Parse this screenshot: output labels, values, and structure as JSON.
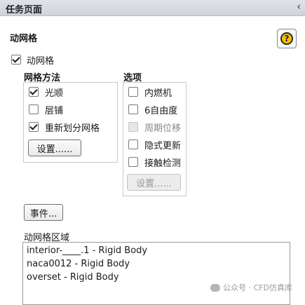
{
  "titlebar": {
    "title": "任务页面",
    "collapse_icon": "chevron-left-icon"
  },
  "panel": {
    "title": "动网格",
    "help_icon": "help-icon",
    "help_glyph": "?"
  },
  "dynamic_mesh": {
    "label": "动网格",
    "checked": true
  },
  "mesh_methods": {
    "title": "网格方法",
    "options": [
      {
        "label": "光顺",
        "checked": true
      },
      {
        "label": "层铺",
        "checked": false
      },
      {
        "label": "重新划分网格",
        "checked": true
      }
    ],
    "settings_button": "设置......"
  },
  "options": {
    "title": "选项",
    "items": [
      {
        "label": "内燃机",
        "checked": false,
        "disabled": false
      },
      {
        "label": "6自由度",
        "checked": false,
        "disabled": false
      },
      {
        "label": "周期位移",
        "checked": false,
        "disabled": true
      },
      {
        "label": "隐式更新",
        "checked": false,
        "disabled": false
      },
      {
        "label": "接触检测",
        "checked": false,
        "disabled": false
      }
    ],
    "settings_button": "设置......"
  },
  "events_button": "事件...",
  "zones": {
    "title": "动网格区域",
    "items": [
      "interior-____.1 - Rigid Body",
      "naca0012 - Rigid Body",
      "overset - Rigid Body"
    ]
  },
  "watermark": {
    "text": "公众号 · CFD仿真库"
  }
}
